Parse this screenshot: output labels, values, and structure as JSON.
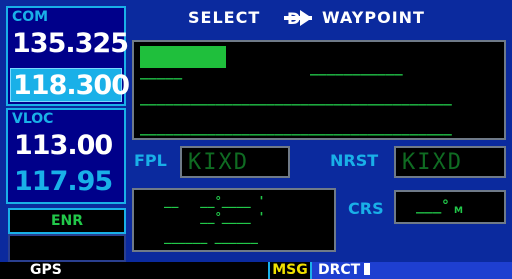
{
  "com": {
    "label": "COM",
    "active": "135.325",
    "standby": "118.300"
  },
  "vloc": {
    "label": "VLOC",
    "active": "113.00",
    "standby": "117.95"
  },
  "mode": {
    "label": "ENR"
  },
  "page_title": {
    "left": "SELECT",
    "right": "WAYPOINT",
    "icon": "direct-to-icon"
  },
  "fpl": {
    "label": "FPL",
    "value": "KIXD"
  },
  "nrst": {
    "label": "NRST",
    "value": "KIXD"
  },
  "crs": {
    "label": "CRS",
    "value": "___°",
    "suffix": "M"
  },
  "status_bar": {
    "gps": "GPS",
    "msg": "MSG",
    "drct": "DRCT"
  },
  "colors": {
    "background": "#0b2a9e",
    "cyan": "#19b0e8",
    "green": "#22c84a",
    "yellow": "#f0e000"
  }
}
